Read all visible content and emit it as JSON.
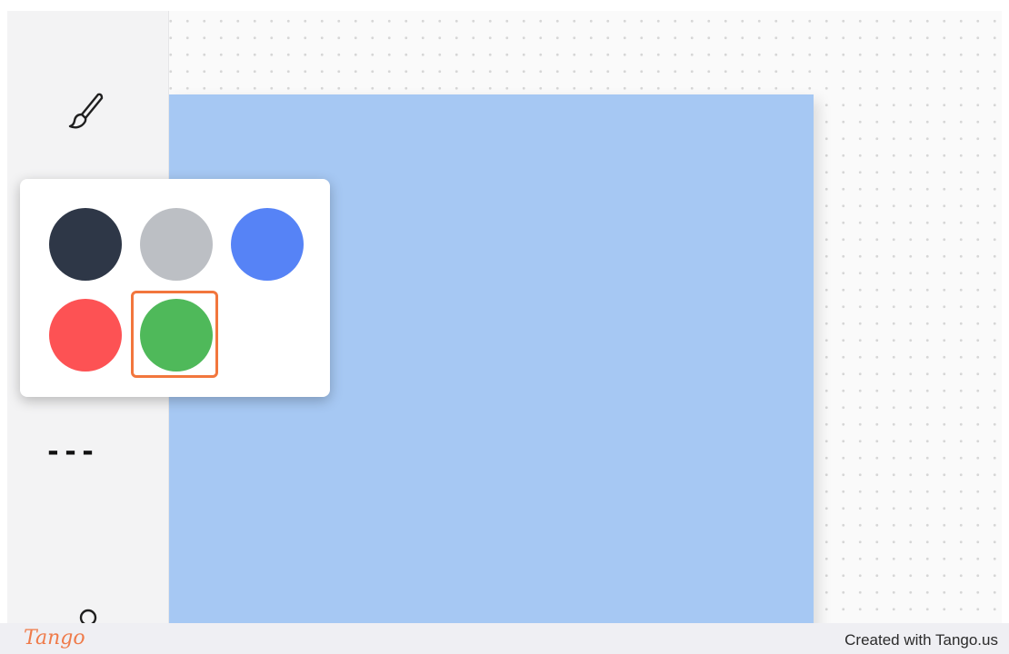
{
  "toolbar": {
    "tools": [
      {
        "icon": "paintbrush-icon"
      },
      {
        "icon": "dashed-line-icon",
        "label": "---"
      },
      {
        "icon": "circle-icon"
      }
    ]
  },
  "color_picker": {
    "swatches": [
      {
        "name": "dark-navy",
        "color": "#2e3747"
      },
      {
        "name": "gray",
        "color": "#bcbfc4"
      },
      {
        "name": "blue",
        "color": "#5683f6"
      },
      {
        "name": "red",
        "color": "#fd5254"
      },
      {
        "name": "green",
        "color": "#4fb95a",
        "selected": true
      }
    ],
    "highlight_color": "#f2763d"
  },
  "canvas": {
    "shape_color": "#a6c8f3"
  },
  "footer": {
    "logo": "Tango",
    "credit": "Created with Tango.us"
  }
}
